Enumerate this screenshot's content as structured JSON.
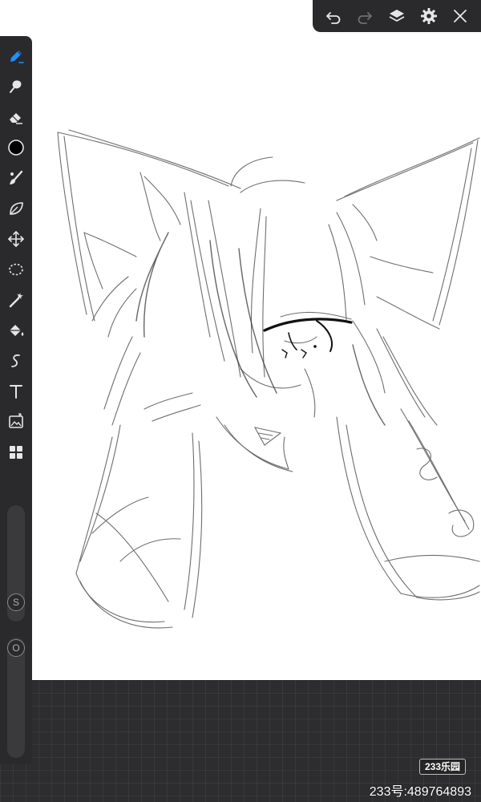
{
  "colors": {
    "active_tool": "#1e90ff",
    "icon": "#e6e6e6",
    "icon_muted": "#6f6f73",
    "canvas": "#ffffff",
    "workspace": "#2d2d30"
  },
  "topbar": {
    "items": [
      {
        "name": "undo-icon",
        "state": "enabled"
      },
      {
        "name": "redo-icon",
        "state": "disabled"
      },
      {
        "name": "layers-icon",
        "state": "enabled"
      },
      {
        "name": "settings-icon",
        "state": "enabled"
      },
      {
        "name": "close-icon",
        "state": "enabled"
      }
    ]
  },
  "sidebar": {
    "tools": [
      {
        "name": "pen-icon",
        "active": true
      },
      {
        "name": "smudge-brush-icon"
      },
      {
        "name": "eraser-icon"
      },
      {
        "name": "color-swatch-icon",
        "color": "#000000"
      },
      {
        "name": "brush-icon"
      },
      {
        "name": "leaf-brush-icon"
      },
      {
        "name": "transform-move-icon"
      },
      {
        "name": "lasso-select-icon"
      },
      {
        "name": "magic-wand-icon"
      },
      {
        "name": "fill-bucket-icon"
      },
      {
        "name": "curve-ruler-icon"
      },
      {
        "name": "text-tool-icon"
      },
      {
        "name": "image-import-icon"
      },
      {
        "name": "grid-layout-icon"
      }
    ],
    "size_slider_label": "S",
    "opacity_slider_label": "O"
  },
  "watermark": {
    "logo_text": "233乐园",
    "id_text": "233号:489764893"
  }
}
